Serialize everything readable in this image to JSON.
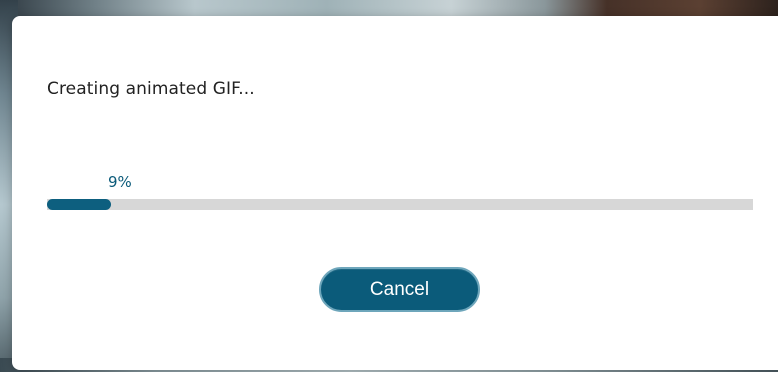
{
  "dialog": {
    "title": "Creating animated GIF...",
    "progress": {
      "percent_text": "9%",
      "value": 0.09
    },
    "cancel_label": "Cancel"
  },
  "colors": {
    "accent": "#0b5b7a",
    "progress_track": "#d7d7d7",
    "dialog_background": "#ffffff"
  }
}
